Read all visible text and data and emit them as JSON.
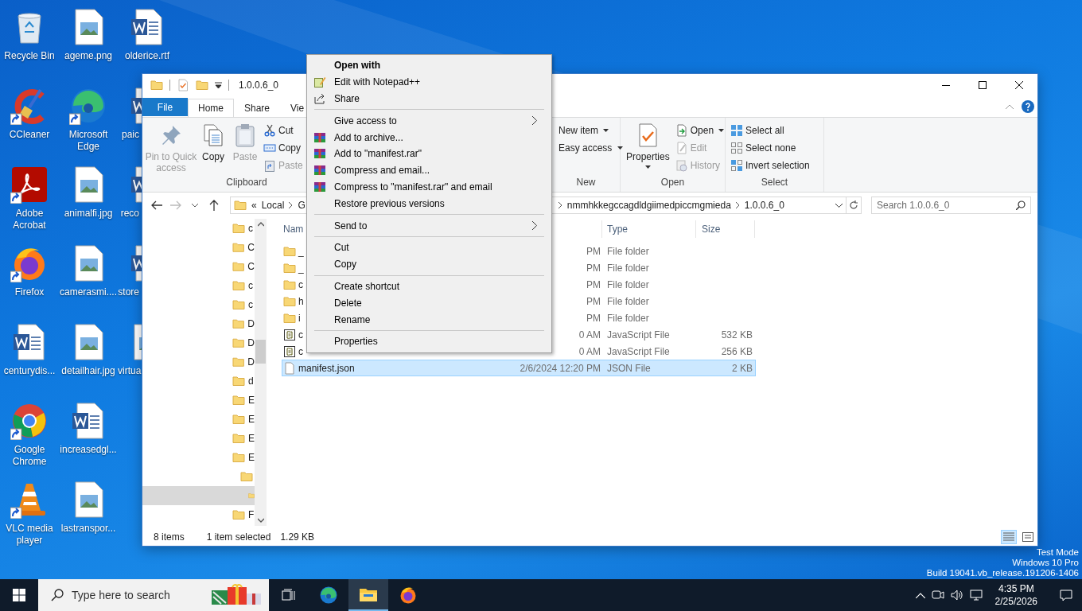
{
  "desktop_columns": [
    [
      {
        "label": "Recycle Bin",
        "kind": "recycle",
        "shortcut": false
      },
      {
        "label": "CCleaner",
        "kind": "ccleaner",
        "shortcut": true
      },
      {
        "label": "Adobe Acrobat",
        "kind": "acrobat",
        "shortcut": true
      },
      {
        "label": "Firefox",
        "kind": "firefox",
        "shortcut": true
      },
      {
        "label": "centurydis...",
        "kind": "word",
        "shortcut": false
      },
      {
        "label": "Google Chrome",
        "kind": "chrome",
        "shortcut": true
      },
      {
        "label": "VLC media player",
        "kind": "vlc",
        "shortcut": true
      }
    ],
    [
      {
        "label": "ageme.png",
        "kind": "image",
        "shortcut": false
      },
      {
        "label": "Microsoft Edge",
        "kind": "edge",
        "shortcut": true
      },
      {
        "label": "animalfi.jpg",
        "kind": "image",
        "shortcut": false
      },
      {
        "label": "camerasmi....",
        "kind": "image",
        "shortcut": false
      },
      {
        "label": "detailhair.jpg",
        "kind": "image",
        "shortcut": false
      },
      {
        "label": "increasedgl...",
        "kind": "word",
        "shortcut": false
      },
      {
        "label": "lastranspor...",
        "kind": "image",
        "shortcut": false
      }
    ],
    [
      {
        "label": "olderice.rtf",
        "kind": "word",
        "shortcut": false
      },
      {
        "label": "paic",
        "kind": "word",
        "shortcut": false
      },
      {
        "label": "reco",
        "kind": "word",
        "shortcut": false
      },
      {
        "label": "store",
        "kind": "word",
        "shortcut": false
      },
      {
        "label": "virtua",
        "kind": "image",
        "shortcut": false
      }
    ]
  ],
  "system_notice": [
    "Test Mode",
    "Windows 10 Pro",
    "Build 19041.vb_release.191206-1406"
  ],
  "window": {
    "title": "1.0.0.6_0",
    "ribbon": {
      "tabs": [
        {
          "label": "File",
          "kind": "file",
          "selected": false
        },
        {
          "label": "Home",
          "kind": "tab",
          "selected": true
        },
        {
          "label": "Share",
          "kind": "tab",
          "selected": false
        },
        {
          "label": "Vie",
          "kind": "tab",
          "selected": false
        }
      ],
      "groups": [
        {
          "label": "Clipboard",
          "commands": [
            {
              "label": "Pin to Quick access",
              "kind": "large",
              "disabled": true,
              "dropdown": false
            },
            {
              "label": "Copy",
              "kind": "large",
              "disabled": false,
              "dropdown": false
            },
            {
              "label": "Paste",
              "kind": "large",
              "disabled": true,
              "dropdown": false
            },
            {
              "label": "Cut",
              "kind": "small",
              "disabled": false,
              "dropdown": false
            },
            {
              "label": "Copy",
              "kind": "small",
              "disabled": false,
              "dropdown": false
            },
            {
              "label": "Paste",
              "kind": "small",
              "disabled": true,
              "dropdown": false
            }
          ]
        },
        {
          "label": "New",
          "commands": [
            {
              "label": "New item",
              "kind": "small",
              "disabled": false,
              "dropdown": true
            },
            {
              "label": "Easy access",
              "kind": "small",
              "disabled": false,
              "dropdown": true
            }
          ]
        },
        {
          "label": "Open",
          "commands": [
            {
              "label": "Properties",
              "kind": "large",
              "disabled": false,
              "dropdown": true
            },
            {
              "label": "Open",
              "kind": "small",
              "disabled": false,
              "dropdown": true
            },
            {
              "label": "Edit",
              "kind": "small",
              "disabled": true,
              "dropdown": false
            },
            {
              "label": "History",
              "kind": "small",
              "disabled": true,
              "dropdown": false
            }
          ]
        },
        {
          "label": "Select",
          "commands": [
            {
              "label": "Select all",
              "kind": "small",
              "disabled": false,
              "dropdown": false
            },
            {
              "label": "Select none",
              "kind": "small",
              "disabled": false,
              "dropdown": false
            },
            {
              "label": "Invert selection",
              "kind": "small",
              "disabled": false,
              "dropdown": false
            }
          ]
        }
      ]
    },
    "address": {
      "before": [
        "«",
        "Local",
        "G"
      ],
      "after": [
        "nmmhkkegccagdldgiimedpiccmgmieda",
        "1.0.0.6_0"
      ]
    },
    "search": {
      "placeholder": "Search 1.0.0.6_0"
    },
    "nav": [
      {
        "label": "c",
        "selected": false
      },
      {
        "label": "C",
        "selected": false
      },
      {
        "label": "C",
        "selected": false
      },
      {
        "label": "c",
        "selected": false
      },
      {
        "label": "c",
        "selected": false
      },
      {
        "label": "D",
        "selected": false
      },
      {
        "label": "D",
        "selected": false
      },
      {
        "label": "D",
        "selected": false
      },
      {
        "label": "d",
        "selected": false
      },
      {
        "label": "E",
        "selected": false
      },
      {
        "label": "E",
        "selected": false
      },
      {
        "label": "E",
        "selected": false
      },
      {
        "label": "E",
        "selected": false,
        "children": [
          {
            "selected": false,
            "children": [
              {
                "selected": true
              }
            ]
          }
        ]
      },
      {
        "label": "F",
        "selected": false
      }
    ],
    "columns": [
      "Nam",
      "Type",
      "Size"
    ],
    "files": [
      {
        "name": "_",
        "kind": "folder",
        "modified": "PM",
        "type": "File folder",
        "selected": false
      },
      {
        "name": "_",
        "kind": "folder",
        "modified": "PM",
        "type": "File folder",
        "selected": false
      },
      {
        "name": "c",
        "kind": "folder",
        "modified": "PM",
        "type": "File folder",
        "selected": false
      },
      {
        "name": "h",
        "kind": "folder",
        "modified": "PM",
        "type": "File folder",
        "selected": false
      },
      {
        "name": "i",
        "kind": "folder",
        "modified": "PM",
        "type": "File folder",
        "selected": false
      },
      {
        "name": "c",
        "kind": "js",
        "modified": "0 AM",
        "type": "JavaScript File",
        "size": "532 KB",
        "selected": false
      },
      {
        "name": "c",
        "kind": "js",
        "modified": "0 AM",
        "type": "JavaScript File",
        "size": "256 KB",
        "selected": false
      },
      {
        "name": "manifest.json",
        "kind": "json",
        "modified": "2/6/2024 12:20 PM",
        "type": "JSON File",
        "size": "2 KB",
        "selected": true
      }
    ],
    "status": {
      "count": "8 items",
      "selection": "1 item selected",
      "selection_size": "1.29 KB"
    },
    "views": [
      {
        "kind": "details",
        "selected": true
      },
      {
        "kind": "large",
        "selected": false
      }
    ]
  },
  "context_menu": {
    "sections": [
      [
        {
          "label": "Open with",
          "kind": "plain",
          "default": true,
          "submenu": false
        },
        {
          "label": "Edit with Notepad++",
          "kind": "notepad",
          "default": false,
          "submenu": false
        },
        {
          "label": "Share",
          "kind": "share",
          "default": false,
          "submenu": false
        }
      ],
      [
        {
          "label": "Give access to",
          "kind": "plain",
          "default": false,
          "submenu": true
        },
        {
          "label": "Add to archive...",
          "kind": "archive",
          "default": false,
          "submenu": false
        },
        {
          "label": "Add to \"manifest.rar\"",
          "kind": "archive",
          "default": false,
          "submenu": false
        },
        {
          "label": "Compress and email...",
          "kind": "archive",
          "default": false,
          "submenu": false
        },
        {
          "label": "Compress to \"manifest.rar\" and email",
          "kind": "archive",
          "default": false,
          "submenu": false
        },
        {
          "label": "Restore previous versions",
          "kind": "plain",
          "default": false,
          "submenu": false
        }
      ],
      [
        {
          "label": "Send to",
          "kind": "plain",
          "default": false,
          "submenu": true
        }
      ],
      [
        {
          "label": "Cut",
          "kind": "plain",
          "default": false,
          "submenu": false
        },
        {
          "label": "Copy",
          "kind": "plain",
          "default": false,
          "submenu": false
        }
      ],
      [
        {
          "label": "Create shortcut",
          "kind": "plain",
          "default": false,
          "submenu": false
        },
        {
          "label": "Delete",
          "kind": "plain",
          "default": false,
          "submenu": false
        },
        {
          "label": "Rename",
          "kind": "plain",
          "default": false,
          "submenu": false
        }
      ],
      [
        {
          "label": "Properties",
          "kind": "plain",
          "default": false,
          "submenu": false
        }
      ]
    ]
  },
  "taskbar": {
    "search_placeholder": "Type here to search",
    "apps": [
      {
        "kind": "taskview",
        "selected": false
      },
      {
        "kind": "edge",
        "selected": false
      },
      {
        "kind": "explorer",
        "selected": true
      },
      {
        "kind": "firefox",
        "selected": false
      }
    ],
    "time": "4:35 PM",
    "date": "2/25/2026"
  }
}
